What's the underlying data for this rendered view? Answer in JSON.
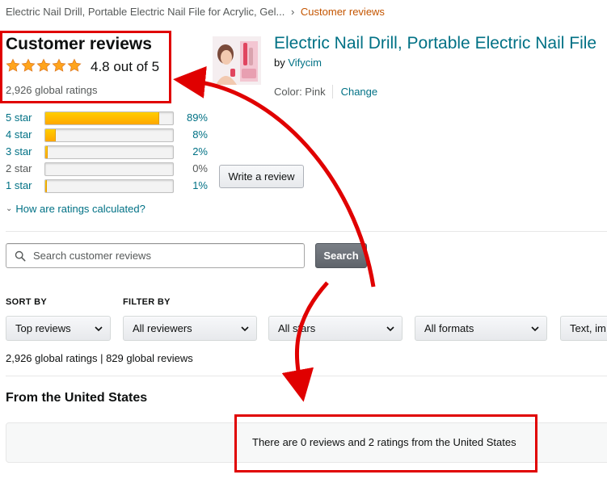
{
  "breadcrumb": {
    "product": "Electric Nail Drill, Portable Electric Nail File for Acrylic, Gel...",
    "separator": "›",
    "current": "Customer reviews"
  },
  "summary": {
    "title": "Customer reviews",
    "rating_text": "4.8 out of 5",
    "rating_value": 4.8,
    "global_ratings": "2,926 global ratings"
  },
  "histogram": [
    {
      "label": "5 star",
      "percent_text": "89%",
      "fraction": 0.89,
      "enabled": true
    },
    {
      "label": "4 star",
      "percent_text": "8%",
      "fraction": 0.08,
      "enabled": true
    },
    {
      "label": "3 star",
      "percent_text": "2%",
      "fraction": 0.02,
      "enabled": true
    },
    {
      "label": "2 star",
      "percent_text": "0%",
      "fraction": 0.0,
      "enabled": false
    },
    {
      "label": "1 star",
      "percent_text": "1%",
      "fraction": 0.01,
      "enabled": true
    }
  ],
  "how_calculated": "How are ratings calculated?",
  "product": {
    "title": "Electric Nail Drill, Portable Electric Nail File",
    "by_prefix": "by",
    "brand": "Vifycim",
    "color_label": "Color: Pink",
    "change_link": "Change"
  },
  "write_review": "Write a review",
  "search": {
    "placeholder": "Search customer reviews",
    "button": "Search"
  },
  "sort": {
    "heading": "SORT BY",
    "selected": "Top reviews"
  },
  "filter": {
    "heading": "FILTER BY",
    "reviewers": "All reviewers",
    "stars": "All stars",
    "formats": "All formats",
    "media": "Text, im"
  },
  "counts_line": "2,926 global ratings | 829 global reviews",
  "from_heading": "From the United States",
  "empty_message": "There are 0 reviews and 2 ratings from the United States",
  "colors": {
    "link": "#007185",
    "star": "#ffa41c",
    "bar_fill": "#ffa700",
    "annotation_red": "#e00000",
    "breadcrumb_current": "#c45500"
  }
}
